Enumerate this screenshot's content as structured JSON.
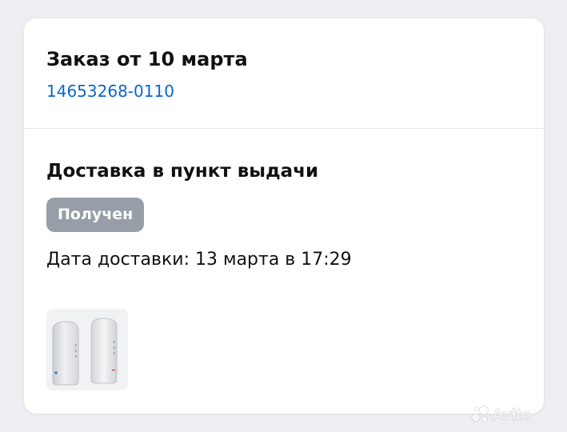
{
  "order": {
    "title": "Заказ от 10 марта",
    "number": "14653268-0110"
  },
  "delivery": {
    "method": "Доставка в пункт выдачи",
    "status": "Получен",
    "date_text": "Дата доставки: 13 марта в 17:29"
  },
  "product": {
    "image_icon": "router-product-image"
  },
  "watermark": {
    "text": "Avito"
  },
  "colors": {
    "link": "#0a67c9",
    "badge_bg": "#969ea8",
    "badge_text": "#ffffff",
    "page_bg": "#eceef1",
    "card_bg": "#ffffff"
  }
}
